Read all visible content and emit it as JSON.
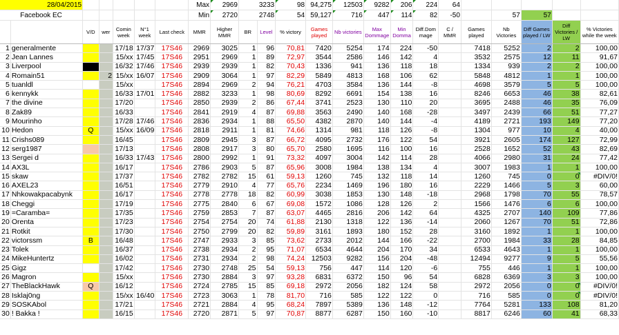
{
  "sheet": {
    "date": "28/04/2015",
    "group": "Facebook EC",
    "max_label": "Max",
    "min_label": "Min",
    "max": {
      "mmr": "2969",
      "higher_mmr": "3233",
      "level": "98",
      "pct": "94,275",
      "games": "12503",
      "nbvic": "9282",
      "maxdom": "206",
      "mindom": "224",
      "diff": "64"
    },
    "min": {
      "mmr": "2720",
      "higher_mmr": "2748",
      "level": "54",
      "pct": "59,127",
      "games": "716",
      "nbvic": "447",
      "maxdom": "114",
      "mindom": "82",
      "diff": "-50"
    },
    "lw_top": {
      "games": "57",
      "vic": "57"
    }
  },
  "headers": {
    "vd": "V/D",
    "wer": "wer",
    "comin": "Comin week",
    "n1": "N°1 week",
    "last": "Last check",
    "mmr": "MMR",
    "higher": "Higher MMR",
    "br": "BR",
    "level": "Level",
    "pct": "% victory",
    "games": "Games played",
    "nbvic": "Nb victories",
    "maxdom": "Max Dommage",
    "mindom": "Min Domma",
    "diffdom": "Diff.Dom mage",
    "cmmr": "C / MMR",
    "gp": "Games played",
    "nbv": "Nb Victories",
    "dgp": "Diff Games played / LW",
    "dv": "Diff Victories / LW",
    "pw": "% Victories while the week"
  },
  "colors": {
    "yellow": "#ffff00",
    "blue": "#8db4e2",
    "green": "#92d050",
    "red": "#e00000",
    "purple": "#8000a0"
  },
  "rows": [
    {
      "n": "1",
      "name": "generalmente",
      "vd": "",
      "vdc": "yellow",
      "wer": "",
      "comin": "17/18",
      "n1": "17/37",
      "last": "17S46",
      "mmr": "2969",
      "higher": "3025",
      "br": "1",
      "level": "96",
      "pct": "70,81",
      "games": "7420",
      "nbvic": "5254",
      "maxdom": "174",
      "mindom": "224",
      "diff": "-50",
      "gp": "7418",
      "nbv": "5252",
      "dgp": "2",
      "dv": "2",
      "pw": "100,00"
    },
    {
      "n": "2",
      "name": "Jean Lannes",
      "vd": "",
      "vdc": "yellow",
      "wer": "",
      "comin": "15/xx",
      "n1": "17/45",
      "last": "17S46",
      "mmr": "2951",
      "higher": "2969",
      "br": "1",
      "level": "89",
      "pct": "72,97",
      "games": "3544",
      "nbvic": "2586",
      "maxdom": "146",
      "mindom": "142",
      "diff": "4",
      "gp": "3532",
      "nbv": "2575",
      "dgp": "12",
      "dv": "11",
      "pw": "91,67"
    },
    {
      "n": "3",
      "name": "Liverpool",
      "vd": "",
      "vdc": "black",
      "wer": "",
      "comin": "16/32",
      "n1": "17/46",
      "last": "17S46",
      "mmr": "2939",
      "higher": "2939",
      "br": "1",
      "level": "82",
      "pct": "70,43",
      "games": "1336",
      "nbvic": "941",
      "maxdom": "136",
      "mindom": "118",
      "diff": "18",
      "gp": "1334",
      "nbv": "939",
      "dgp": "2",
      "dv": "2",
      "pw": "100,00"
    },
    {
      "n": "4",
      "name": "Romain51",
      "vd": "",
      "vdc": "yellow",
      "wer": "2",
      "comin": "15/xx",
      "n1": "16/07",
      "last": "17S46",
      "mmr": "2909",
      "higher": "3064",
      "br": "1",
      "level": "97",
      "pct": "82,29",
      "games": "5849",
      "nbvic": "4813",
      "maxdom": "168",
      "mindom": "106",
      "diff": "62",
      "gp": "5848",
      "nbv": "4812",
      "dgp": "1",
      "dv": "1",
      "pw": "100,00"
    },
    {
      "n": "5",
      "name": "tuanldl",
      "vd": "",
      "vdc": "",
      "wer": "",
      "comin": "15/xx",
      "n1": "",
      "last": "17S46",
      "mmr": "2894",
      "higher": "2969",
      "br": "2",
      "level": "94",
      "pct": "76,21",
      "games": "4703",
      "nbvic": "3584",
      "maxdom": "136",
      "mindom": "144",
      "diff": "-8",
      "gp": "4698",
      "nbv": "3579",
      "dgp": "5",
      "dv": "5",
      "pw": "100,00"
    },
    {
      "n": "6",
      "name": "kennykk",
      "vd": "",
      "vdc": "yellow",
      "wer": "",
      "comin": "16/33",
      "n1": "17/01",
      "last": "17S46",
      "mmr": "2882",
      "higher": "3233",
      "br": "1",
      "level": "98",
      "pct": "80,69",
      "games": "8292",
      "nbvic": "6691",
      "maxdom": "154",
      "mindom": "138",
      "diff": "16",
      "gp": "8246",
      "nbv": "6653",
      "dgp": "46",
      "dv": "38",
      "pw": "82,61"
    },
    {
      "n": "7",
      "name": "the divine",
      "vd": "",
      "vdc": "yellow",
      "wer": "",
      "comin": "17/20",
      "n1": "",
      "last": "17S46",
      "mmr": "2850",
      "higher": "2939",
      "br": "2",
      "level": "86",
      "pct": "67,44",
      "games": "3741",
      "nbvic": "2523",
      "maxdom": "130",
      "mindom": "110",
      "diff": "20",
      "gp": "3695",
      "nbv": "2488",
      "dgp": "46",
      "dv": "35",
      "pw": "76,09"
    },
    {
      "n": "8",
      "name": "Zak89",
      "vd": "",
      "vdc": "yellow",
      "wer": "",
      "comin": "16/33",
      "n1": "",
      "last": "17S46",
      "mmr": "2841",
      "higher": "2919",
      "br": "4",
      "level": "87",
      "pct": "69,88",
      "games": "3563",
      "nbvic": "2490",
      "maxdom": "140",
      "mindom": "168",
      "diff": "-28",
      "gp": "3497",
      "nbv": "2439",
      "dgp": "66",
      "dv": "51",
      "pw": "77,27"
    },
    {
      "n": "9",
      "name": "Mourinho",
      "vd": "",
      "vdc": "yellow",
      "wer": "",
      "comin": "17/28",
      "n1": "17/46",
      "last": "17S46",
      "mmr": "2836",
      "higher": "2934",
      "br": "1",
      "level": "88",
      "pct": "65,50",
      "games": "4382",
      "nbvic": "2870",
      "maxdom": "140",
      "mindom": "144",
      "diff": "-4",
      "gp": "4189",
      "nbv": "2721",
      "dgp": "193",
      "dv": "149",
      "pw": "77,20"
    },
    {
      "n": "10",
      "name": "Hedon",
      "vd": "Q",
      "vdc": "yellow",
      "wer": "",
      "comin": "15/xx",
      "n1": "16/09",
      "last": "17S46",
      "mmr": "2818",
      "higher": "2911",
      "br": "1",
      "level": "81",
      "pct": "74,66",
      "games": "1314",
      "nbvic": "981",
      "maxdom": "118",
      "mindom": "126",
      "diff": "-8",
      "gp": "1304",
      "nbv": "977",
      "dgp": "10",
      "dv": "4",
      "pw": "40,00"
    },
    {
      "n": "11",
      "name": "Crishs089",
      "vd": "",
      "vdc": "yellow",
      "wer": "",
      "comin": "16/45",
      "n1": "",
      "last": "17S46",
      "mmr": "2809",
      "higher": "2945",
      "br": "3",
      "level": "87",
      "pct": "66,72",
      "games": "4095",
      "nbvic": "2732",
      "maxdom": "176",
      "mindom": "122",
      "diff": "54",
      "gp": "3921",
      "nbv": "2605",
      "dgp": "174",
      "dv": "127",
      "pw": "72,99"
    },
    {
      "n": "12",
      "name": "serg1987",
      "vd": "",
      "vdc": "peach",
      "wer": "",
      "comin": "17/13",
      "n1": "",
      "last": "17S46",
      "mmr": "2808",
      "higher": "2917",
      "br": "3",
      "level": "80",
      "pct": "65,70",
      "games": "2580",
      "nbvic": "1695",
      "maxdom": "116",
      "mindom": "100",
      "diff": "16",
      "gp": "2528",
      "nbv": "1652",
      "dgp": "52",
      "dv": "43",
      "pw": "82,69"
    },
    {
      "n": "13",
      "name": "Sergei d",
      "vd": "",
      "vdc": "yellow",
      "wer": "",
      "comin": "16/33",
      "n1": "17/43",
      "last": "17S46",
      "mmr": "2800",
      "higher": "2992",
      "br": "1",
      "level": "91",
      "pct": "73,32",
      "games": "4097",
      "nbvic": "3004",
      "maxdom": "142",
      "mindom": "114",
      "diff": "28",
      "gp": "4066",
      "nbv": "2980",
      "dgp": "31",
      "dv": "24",
      "pw": "77,42"
    },
    {
      "n": "14",
      "name": "AX3L",
      "vd": "",
      "vdc": "yellow",
      "wer": "",
      "comin": "16/17",
      "n1": "",
      "last": "17S46",
      "mmr": "2786",
      "higher": "2903",
      "br": "5",
      "level": "87",
      "pct": "65,96",
      "games": "3008",
      "nbvic": "1984",
      "maxdom": "138",
      "mindom": "134",
      "diff": "4",
      "gp": "3007",
      "nbv": "1983",
      "dgp": "1",
      "dv": "1",
      "pw": "100,00"
    },
    {
      "n": "15",
      "name": "skaw",
      "vd": "",
      "vdc": "yellow",
      "wer": "",
      "comin": "17/37",
      "n1": "",
      "last": "17S46",
      "mmr": "2782",
      "higher": "2782",
      "br": "15",
      "level": "61",
      "pct": "59,13",
      "games": "1260",
      "nbvic": "745",
      "maxdom": "132",
      "mindom": "118",
      "diff": "14",
      "gp": "1260",
      "nbv": "745",
      "dgp": "0",
      "dv": "0",
      "pw": "#DIV/0!"
    },
    {
      "n": "16",
      "name": "AXEL23",
      "vd": "",
      "vdc": "yellow",
      "wer": "",
      "comin": "16/51",
      "n1": "",
      "last": "17S46",
      "mmr": "2779",
      "higher": "2910",
      "br": "4",
      "level": "77",
      "pct": "65,76",
      "games": "2234",
      "nbvic": "1469",
      "maxdom": "196",
      "mindom": "180",
      "diff": "16",
      "gp": "2229",
      "nbv": "1466",
      "dgp": "5",
      "dv": "3",
      "pw": "60,00"
    },
    {
      "n": "17",
      "name": "Nhkowakpacabynk",
      "vd": "",
      "vdc": "yellow",
      "wer": "",
      "comin": "16/17",
      "n1": "",
      "last": "17S46",
      "mmr": "2778",
      "higher": "2778",
      "br": "18",
      "level": "82",
      "pct": "60,99",
      "games": "3038",
      "nbvic": "1853",
      "maxdom": "130",
      "mindom": "148",
      "diff": "-18",
      "gp": "2968",
      "nbv": "1798",
      "dgp": "70",
      "dv": "55",
      "pw": "78,57"
    },
    {
      "n": "18",
      "name": "Cheggi",
      "vd": "",
      "vdc": "yellow",
      "wer": "",
      "comin": "17/19",
      "n1": "",
      "last": "17S46",
      "mmr": "2775",
      "higher": "2840",
      "br": "6",
      "level": "67",
      "pct": "69,08",
      "games": "1572",
      "nbvic": "1086",
      "maxdom": "128",
      "mindom": "126",
      "diff": "2",
      "gp": "1566",
      "nbv": "1476",
      "dgp": "6",
      "dv": "6",
      "pw": "100,00"
    },
    {
      "n": "19",
      "name": "=Caramba=",
      "vd": "",
      "vdc": "yellow",
      "wer": "",
      "comin": "17/35",
      "n1": "",
      "last": "17S46",
      "mmr": "2759",
      "higher": "2853",
      "br": "7",
      "level": "87",
      "pct": "63,07",
      "games": "4465",
      "nbvic": "2816",
      "maxdom": "206",
      "mindom": "142",
      "diff": "64",
      "gp": "4325",
      "nbv": "2707",
      "dgp": "140",
      "dv": "109",
      "pw": "77,86"
    },
    {
      "n": "20",
      "name": "Orenta",
      "vd": "",
      "vdc": "yellow",
      "wer": "",
      "comin": "17/23",
      "n1": "",
      "last": "17S46",
      "mmr": "2754",
      "higher": "2754",
      "br": "20",
      "level": "74",
      "pct": "61,88",
      "games": "2130",
      "nbvic": "1318",
      "maxdom": "122",
      "mindom": "136",
      "diff": "-14",
      "gp": "2060",
      "nbv": "1267",
      "dgp": "70",
      "dv": "51",
      "pw": "72,86"
    },
    {
      "n": "21",
      "name": "Rotkit",
      "vd": "",
      "vdc": "yellow",
      "wer": "",
      "comin": "17/30",
      "n1": "",
      "last": "17S46",
      "mmr": "2750",
      "higher": "2799",
      "br": "20",
      "level": "82",
      "pct": "59,89",
      "games": "3161",
      "nbvic": "1893",
      "maxdom": "180",
      "mindom": "152",
      "diff": "28",
      "gp": "3160",
      "nbv": "1892",
      "dgp": "1",
      "dv": "1",
      "pw": "100,00"
    },
    {
      "n": "22",
      "name": "victorssm",
      "vd": "B",
      "vdc": "yellow",
      "wer": "",
      "comin": "16/48",
      "n1": "",
      "last": "17S46",
      "mmr": "2747",
      "higher": "2933",
      "br": "3",
      "level": "85",
      "pct": "73,62",
      "games": "2733",
      "nbvic": "2012",
      "maxdom": "144",
      "mindom": "166",
      "diff": "-22",
      "gp": "2700",
      "nbv": "1984",
      "dgp": "33",
      "dv": "28",
      "pw": "84,85"
    },
    {
      "n": "23",
      "name": "Tolek",
      "vd": "",
      "vdc": "yellow",
      "wer": "",
      "comin": "16/37",
      "n1": "",
      "last": "17S46",
      "mmr": "2738",
      "higher": "2934",
      "br": "2",
      "level": "95",
      "pct": "71,07",
      "games": "6534",
      "nbvic": "4644",
      "maxdom": "204",
      "mindom": "170",
      "diff": "34",
      "gp": "6533",
      "nbv": "4643",
      "dgp": "1",
      "dv": "1",
      "pw": "100,00"
    },
    {
      "n": "24",
      "name": "MikeHuntertz",
      "vd": "",
      "vdc": "yellow",
      "wer": "",
      "comin": "16/02",
      "n1": "",
      "last": "17S46",
      "mmr": "2731",
      "higher": "2934",
      "br": "2",
      "level": "98",
      "pct": "74,24",
      "games": "12503",
      "nbvic": "9282",
      "maxdom": "156",
      "mindom": "204",
      "diff": "-48",
      "gp": "12494",
      "nbv": "9277",
      "dgp": "9",
      "dv": "5",
      "pw": "55,56"
    },
    {
      "n": "25",
      "name": "Gigz",
      "vd": "",
      "vdc": "",
      "wer": "",
      "comin": "17/42",
      "n1": "",
      "last": "17S46",
      "mmr": "2730",
      "higher": "2748",
      "br": "25",
      "level": "54",
      "pct": "59,13",
      "games": "756",
      "nbvic": "447",
      "maxdom": "114",
      "mindom": "120",
      "diff": "-6",
      "gp": "755",
      "nbv": "446",
      "dgp": "1",
      "dv": "1",
      "pw": "100,00"
    },
    {
      "n": "26",
      "name": "Magron",
      "vd": "",
      "vdc": "yellow",
      "wer": "",
      "comin": "15/xx",
      "n1": "",
      "last": "17S46",
      "mmr": "2730",
      "higher": "2884",
      "br": "3",
      "level": "97",
      "pct": "93,28",
      "games": "6831",
      "nbvic": "6372",
      "maxdom": "150",
      "mindom": "96",
      "diff": "54",
      "gp": "6828",
      "nbv": "6369",
      "dgp": "3",
      "dv": "3",
      "pw": "100,00"
    },
    {
      "n": "27",
      "name": "TheBlackHawk",
      "vd": "Q",
      "vdc": "peach",
      "wer": "",
      "comin": "16/12",
      "n1": "",
      "last": "17S46",
      "mmr": "2724",
      "higher": "2785",
      "br": "15",
      "level": "85",
      "pct": "69,18",
      "games": "2972",
      "nbvic": "2056",
      "maxdom": "182",
      "mindom": "124",
      "diff": "58",
      "gp": "2972",
      "nbv": "2056",
      "dgp": "0",
      "dv": "0",
      "pw": "#DIV/0!"
    },
    {
      "n": "28",
      "name": "Isklaj0ng",
      "vd": "",
      "vdc": "yellow",
      "wer": "",
      "comin": "15/xx",
      "n1": "16/40",
      "last": "17S46",
      "mmr": "2723",
      "higher": "3063",
      "br": "1",
      "level": "78",
      "pct": "81,70",
      "games": "716",
      "nbvic": "585",
      "maxdom": "122",
      "mindom": "122",
      "diff": "0",
      "gp": "716",
      "nbv": "585",
      "dgp": "0",
      "dv": "0",
      "pw": "#DIV/0!"
    },
    {
      "n": "29",
      "name": "SOSKAbol",
      "vd": "",
      "vdc": "yellow",
      "wer": "",
      "comin": "17/21",
      "n1": "",
      "last": "17S46",
      "mmr": "2721",
      "higher": "2884",
      "br": "4",
      "level": "95",
      "pct": "68,24",
      "games": "7897",
      "nbvic": "5389",
      "maxdom": "136",
      "mindom": "148",
      "diff": "-12",
      "gp": "7764",
      "nbv": "5281",
      "dgp": "133",
      "dv": "108",
      "pw": "81,20"
    },
    {
      "n": "30",
      "name": "! Bakka !",
      "vd": "",
      "vdc": "yellow",
      "wer": "",
      "comin": "16/15",
      "n1": "",
      "last": "17S46",
      "mmr": "2720",
      "higher": "2871",
      "br": "5",
      "level": "97",
      "pct": "70,87",
      "games": "8877",
      "nbvic": "6287",
      "maxdom": "150",
      "mindom": "160",
      "diff": "-10",
      "gp": "8817",
      "nbv": "6246",
      "dgp": "60",
      "dv": "41",
      "pw": "68,33"
    }
  ]
}
